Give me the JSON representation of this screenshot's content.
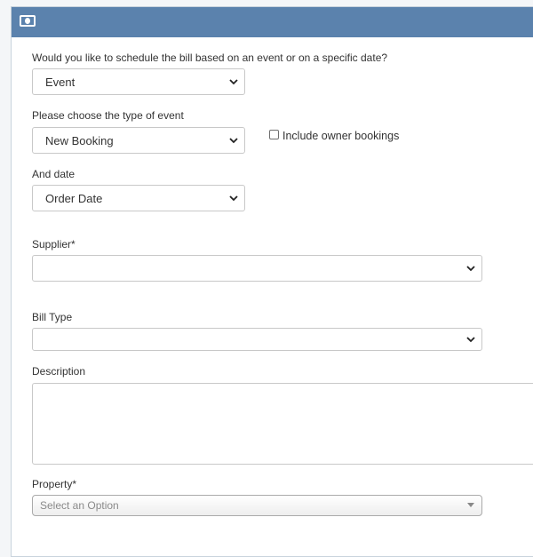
{
  "header": {
    "icon": "banknote-icon",
    "background": "#5b82ad"
  },
  "schedule": {
    "question": "Would you like to schedule the bill based on an event or on a specific date?",
    "value": "Event"
  },
  "event_type": {
    "label": "Please choose the type of event",
    "value": "New Booking"
  },
  "owner_bookings": {
    "label": "Include owner bookings",
    "checked": false
  },
  "and_date": {
    "label": "And date",
    "value": "Order Date"
  },
  "supplier": {
    "label": "Supplier*",
    "value": ""
  },
  "bill_type": {
    "label": "Bill Type",
    "value": ""
  },
  "description": {
    "label": "Description",
    "value": ""
  },
  "property": {
    "label": "Property*",
    "placeholder": "Select an Option"
  }
}
